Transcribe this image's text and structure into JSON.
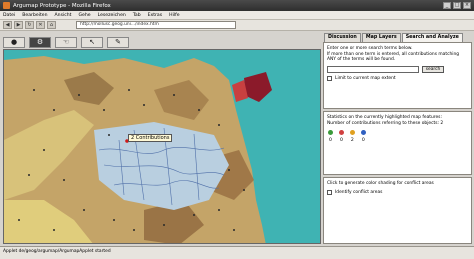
{
  "window": {
    "title": "Argumap Prototype - Mozilla Firefox"
  },
  "menu": [
    "Datei",
    "Bearbeiten",
    "Ansicht",
    "Gehe",
    "Lesezeichen",
    "Tab",
    "Extras",
    "Hilfe"
  ],
  "address": {
    "url": "http://mollusc.geog.uni.../index.htm"
  },
  "tabs": [
    "Discussion",
    "Map Layers",
    "Search and Analyze"
  ],
  "search": {
    "intro": "Enter one or more search terms below.",
    "hint": "If more than one term is entered, all contributions matching ANY of the terms will be found.",
    "input_value": "",
    "button": "search",
    "limit_label": "Limit to current map extent"
  },
  "stats": {
    "title": "Statistics on the currently highlighted map features:",
    "count_label": "Number of contributions referring to these objects: 2",
    "counts": [
      "0",
      "0",
      "2",
      "0"
    ]
  },
  "conflict": {
    "title": "Click to generate color shading for conflict areas",
    "checkbox_label": "Identify conflict areas"
  },
  "map": {
    "tooltip": "2 Contributions"
  },
  "status": {
    "text": "Applet de/geog/argumap/ArgumapApplet started"
  },
  "colors": {
    "water": "#3fb3b3",
    "terrain": "#c9a86a",
    "highlight": "#8b1a2a"
  }
}
